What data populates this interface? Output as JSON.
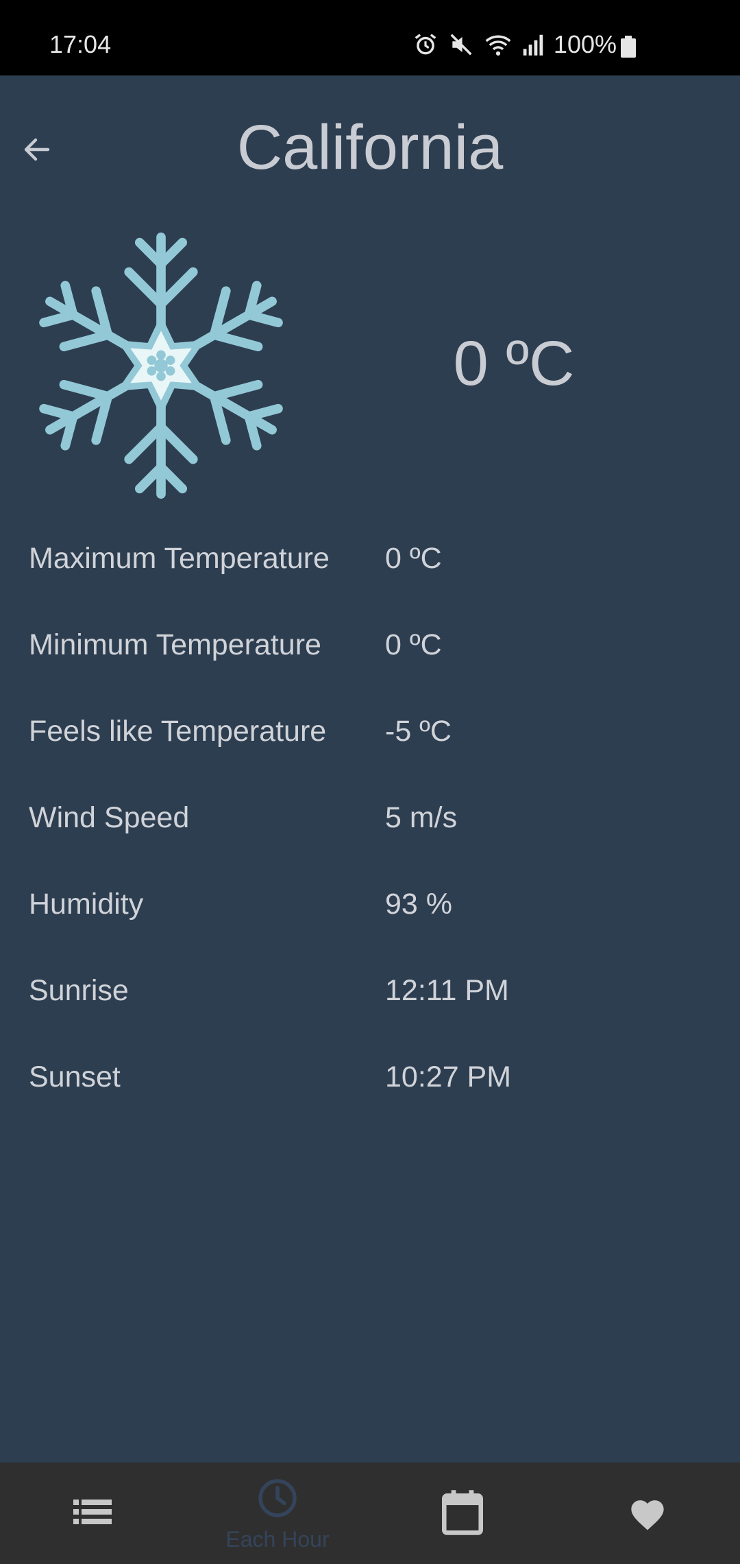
{
  "status_bar": {
    "time": "17:04",
    "battery": "100%"
  },
  "header": {
    "title": "California"
  },
  "current": {
    "temperature": "0 ºC",
    "icon": "snowflake-icon"
  },
  "details": [
    {
      "label": "Maximum Temperature",
      "value": "0 ºC"
    },
    {
      "label": "Minimum Temperature",
      "value": "0 ºC"
    },
    {
      "label": "Feels like Temperature",
      "value": "-5 ºC"
    },
    {
      "label": "Wind Speed",
      "value": "5 m/s"
    },
    {
      "label": "Humidity",
      "value": "93 %"
    },
    {
      "label": "Sunrise",
      "value": "12:11 PM"
    },
    {
      "label": "Sunset",
      "value": "10:27 PM"
    }
  ],
  "bottom_nav": {
    "items": [
      {
        "icon": "list-icon",
        "label": ""
      },
      {
        "icon": "clock-icon",
        "label": "Each Hour"
      },
      {
        "icon": "calendar-icon",
        "label": ""
      },
      {
        "icon": "heart-icon",
        "label": ""
      }
    ]
  },
  "colors": {
    "background": "#2e3e51",
    "nav_background": "#2f2f2f",
    "snowflake": "#93c9d6",
    "snowflake_center": "#e9f6f8"
  }
}
